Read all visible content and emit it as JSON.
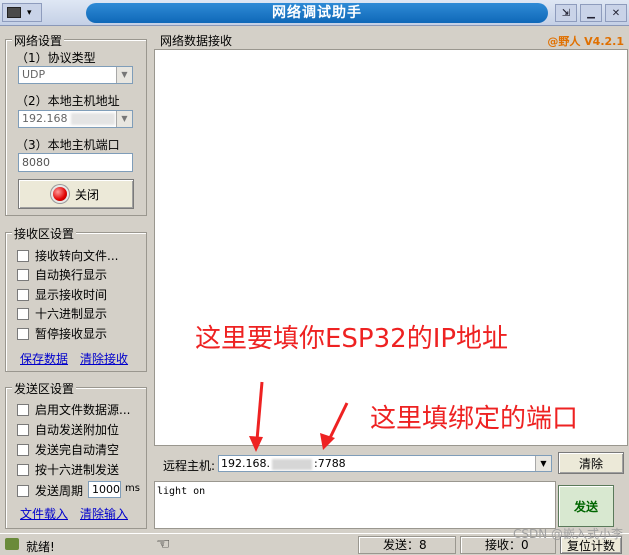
{
  "window": {
    "title": "网络调试助手",
    "menu_glyph": "▸",
    "menu_down": "▾"
  },
  "brand": "@野人 V4.2.1",
  "network": {
    "group_title": "网络设置",
    "protocol_label": "（1）协议类型",
    "protocol_value": "UDP",
    "host_label": "（2）本地主机地址",
    "host_value": "192.168",
    "port_label": "（3）本地主机端口",
    "port_value": "8080",
    "close_label": "关闭"
  },
  "recv_settings": {
    "group_title": "接收区设置",
    "options": [
      "接收转向文件...",
      "自动换行显示",
      "显示接收时间",
      "十六进制显示",
      "暂停接收显示"
    ],
    "save_link": "保存数据",
    "clear_link": "清除接收"
  },
  "send_settings": {
    "group_title": "发送区设置",
    "options": [
      "启用文件数据源...",
      "自动发送附加位",
      "发送完自动清空",
      "按十六进制发送"
    ],
    "period_label": "发送周期",
    "period_value": "1000",
    "period_unit": "ms",
    "load_link": "文件载入",
    "clear_link": "清除输入"
  },
  "recv_area": {
    "title": "网络数据接收"
  },
  "annotations": {
    "ip_note": "这里要填你ESP32的IP地址",
    "port_note": "这里填绑定的端口"
  },
  "remote": {
    "label": "远程主机:",
    "ip_prefix": "192.168.",
    "port_suffix": ":7788",
    "clear_button": "清除"
  },
  "send_area": {
    "text": "light on",
    "send_button": "发送"
  },
  "status": {
    "ready": "就绪!",
    "sent_label": "发送：8",
    "recv_label": "接收：0",
    "reset_button": "复位计数"
  },
  "watermark": "CSDN @嵌入式小李",
  "colors": {
    "title_bar": "#1a74c8",
    "annotation": "#ee2222",
    "brand": "#e07000",
    "send_button_text": "#006600"
  }
}
